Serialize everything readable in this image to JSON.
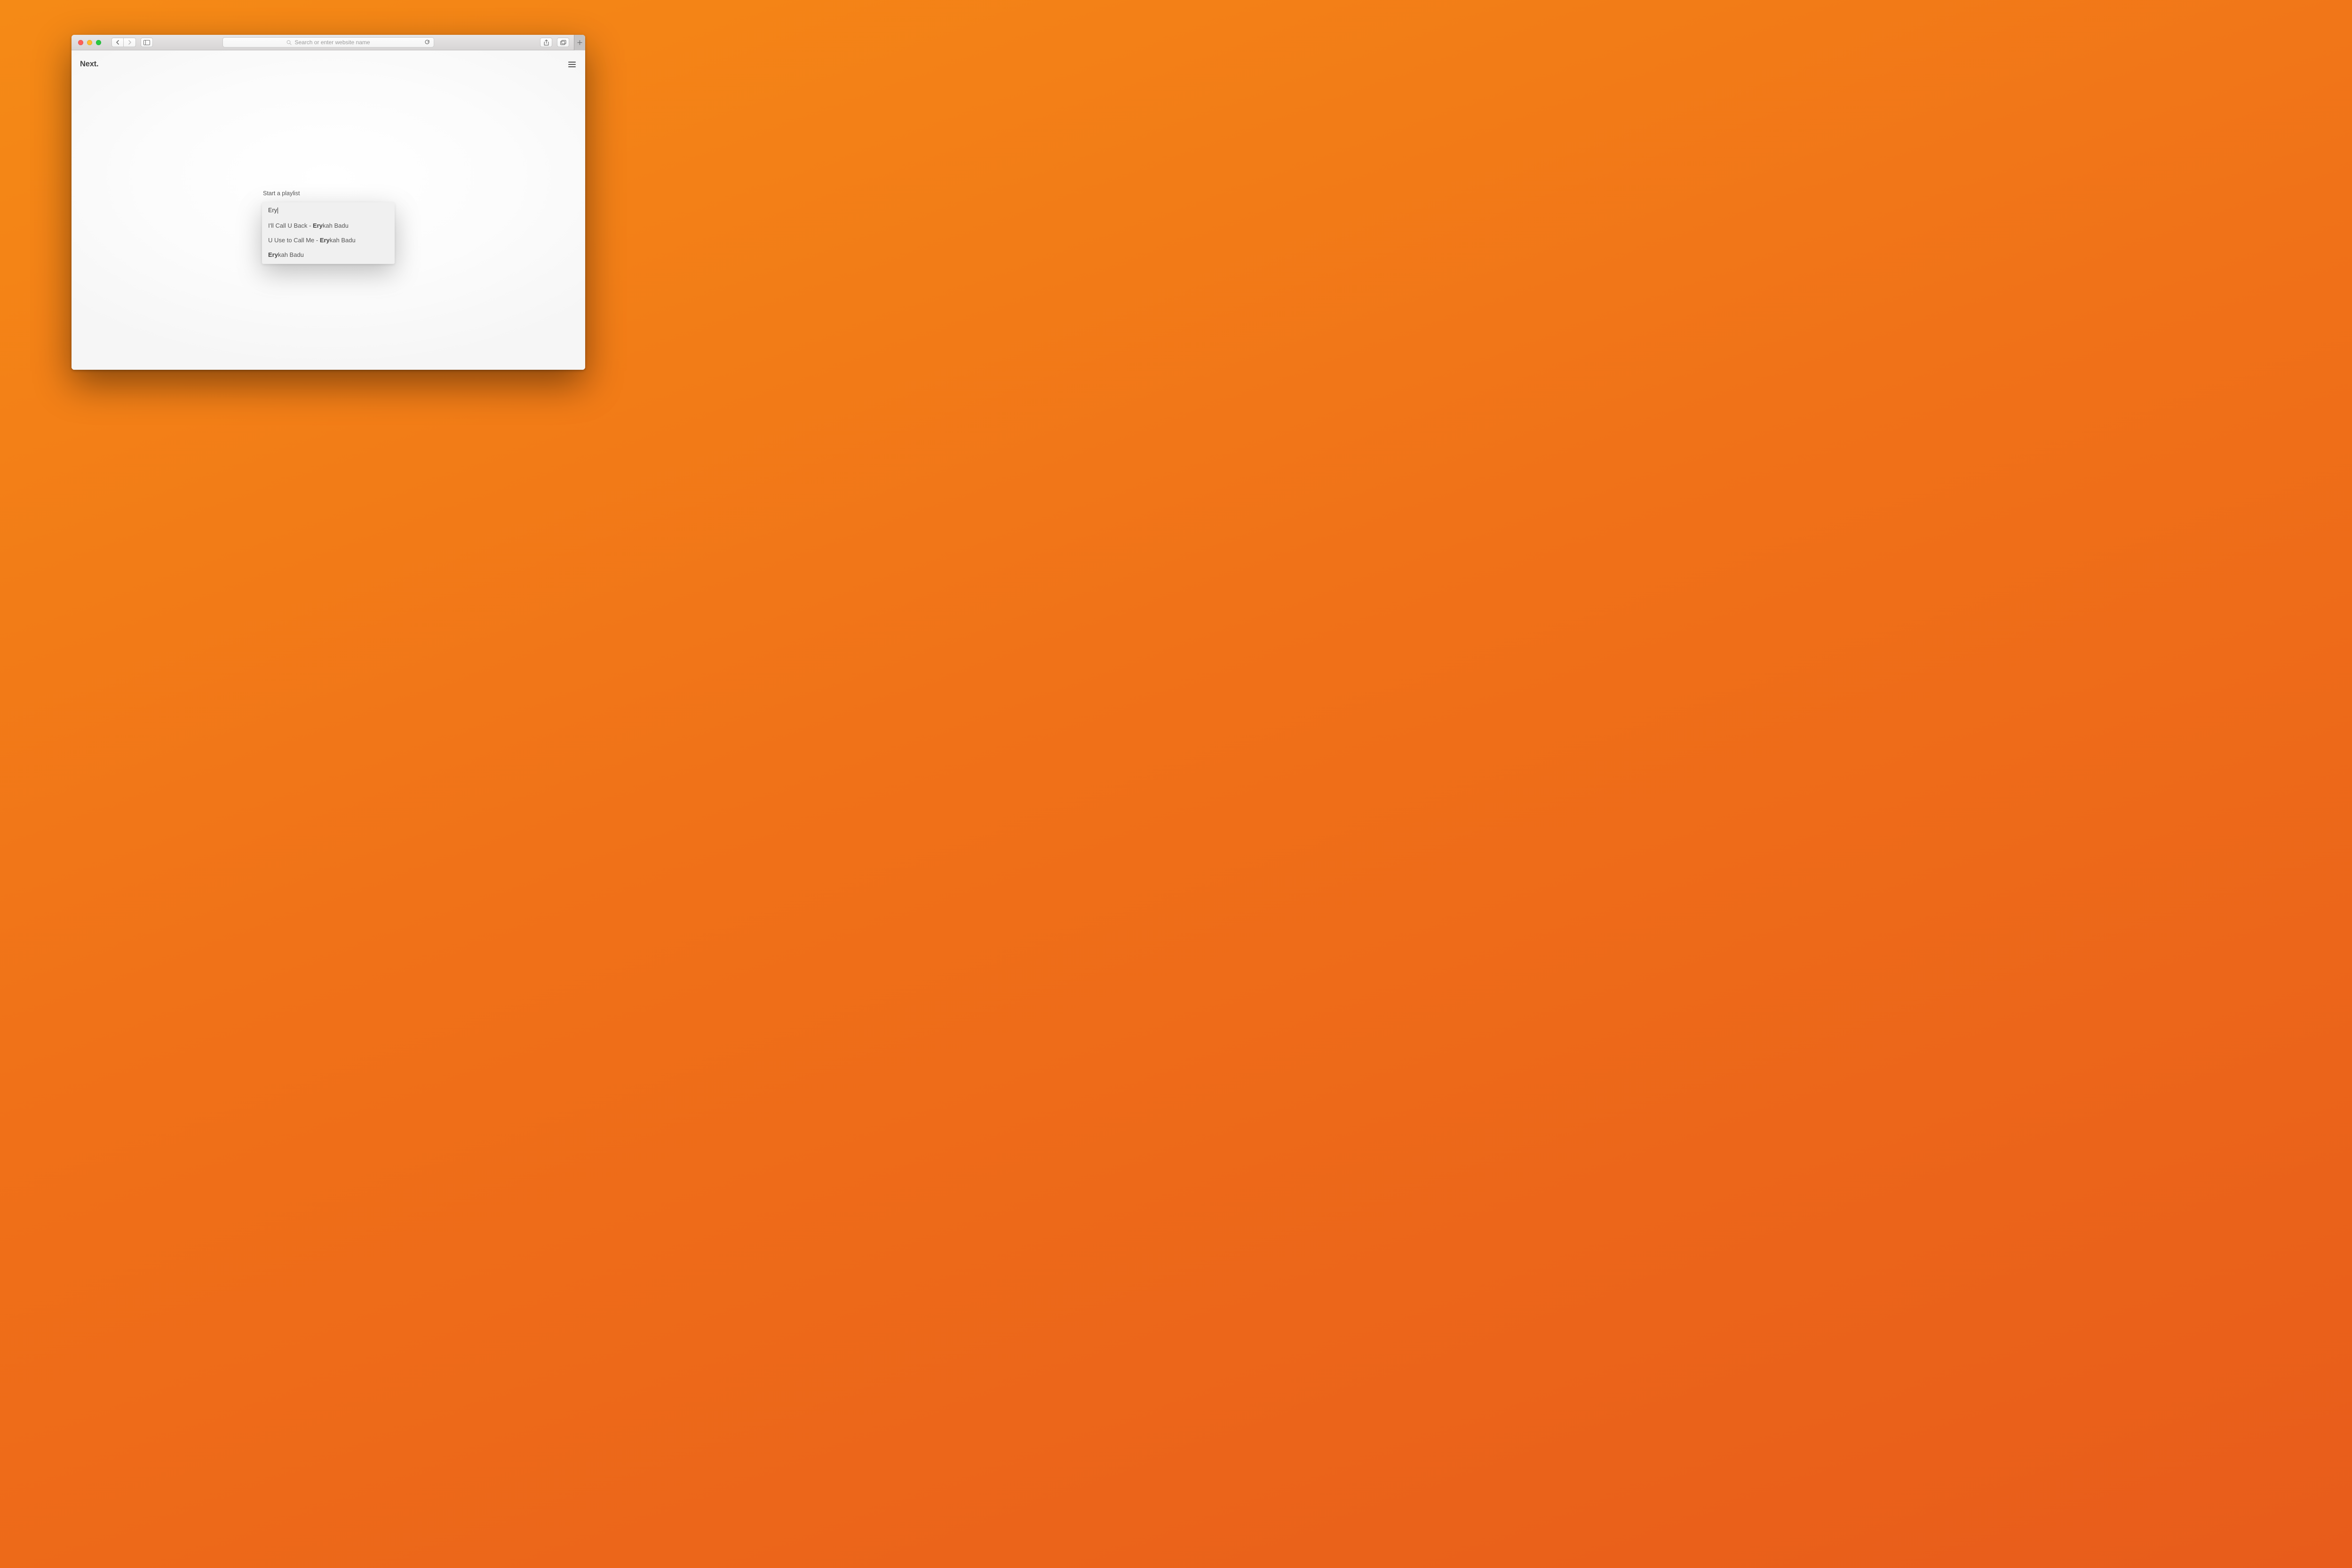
{
  "browser": {
    "address_placeholder": "Search or enter website name"
  },
  "app": {
    "title": "Next."
  },
  "search": {
    "label": "Start a playlist",
    "query": "Ery",
    "suggestions": [
      {
        "prefix": "I'll Call U Back - ",
        "match": "Ery",
        "suffix": "kah Badu"
      },
      {
        "prefix": "U Use to Call Me - ",
        "match": "Ery",
        "suffix": "kah Badu"
      },
      {
        "prefix": "",
        "match": "Ery",
        "suffix": "kah Badu"
      }
    ]
  }
}
